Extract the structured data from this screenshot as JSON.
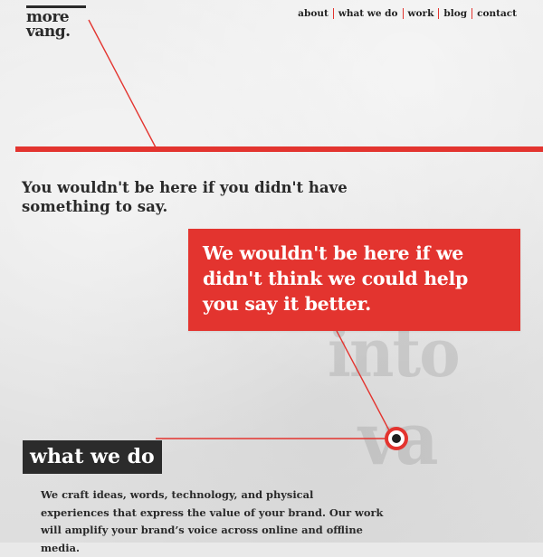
{
  "logo": {
    "line1": "more",
    "line2": "vang."
  },
  "nav": {
    "items": [
      {
        "label": "about"
      },
      {
        "label": "what we do"
      },
      {
        "label": "work"
      },
      {
        "label": "blog"
      },
      {
        "label": "contact"
      }
    ]
  },
  "background_text": {
    "line1": "into",
    "line2": "va"
  },
  "hero": {
    "intro": "You wouldn't be here if you didn't have something to say.",
    "callout": "We wouldn't be here if we didn't think we could help you say it better."
  },
  "section": {
    "title": "what we do",
    "body": "We craft ideas, words, technology, and physical experiences that express the value of your brand. Our work will amplify your brand’s voice across online and offline media."
  },
  "colors": {
    "accent": "#e3342f",
    "dark": "#2b2b2b",
    "background": "#e9e9e9"
  },
  "icons": {
    "timeline_node": "target-node-icon"
  }
}
